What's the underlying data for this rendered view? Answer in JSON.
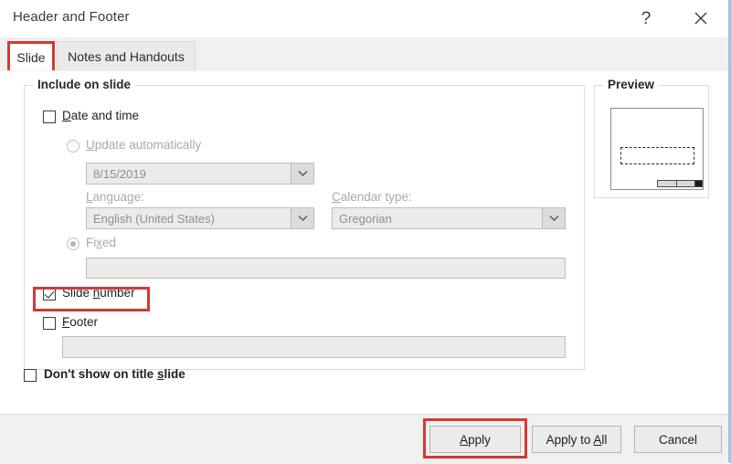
{
  "window": {
    "title": "Header and Footer",
    "help_icon": "question-mark-icon",
    "close_icon": "close-icon"
  },
  "tabs": [
    {
      "label": "Slide",
      "active": true,
      "highlighted": true
    },
    {
      "label": "Notes and Handouts",
      "active": false,
      "highlighted": false
    }
  ],
  "include_group": {
    "legend": "Include on slide",
    "date_and_time": {
      "label_pre": "",
      "label_accel": "D",
      "label_post": "ate and time",
      "checked": false
    },
    "update_automatically": {
      "label_accel": "U",
      "label_post": "pdate automatically",
      "selected": false,
      "disabled": true
    },
    "date_combo": {
      "value": "8/15/2019",
      "disabled": true,
      "arrow_icon": "chevron-down-icon"
    },
    "language": {
      "label_accel": "L",
      "label_post": "anguage:",
      "value": "English (United States)",
      "disabled": true,
      "arrow_icon": "chevron-down-icon"
    },
    "calendar_type": {
      "label_accel": "C",
      "label_post": "alendar type:",
      "value": "Gregorian",
      "disabled": true,
      "arrow_icon": "chevron-down-icon"
    },
    "fixed": {
      "label_pre": "Fi",
      "label_accel": "x",
      "label_post": "ed",
      "selected": true,
      "disabled": true
    },
    "fixed_field": {
      "value": "",
      "placeholder": "",
      "disabled": true
    },
    "slide_number": {
      "label_pre": "Slide ",
      "label_accel": "n",
      "label_post": "umber",
      "checked": true,
      "highlighted": true
    },
    "footer": {
      "label_accel": "F",
      "label_post": "ooter",
      "checked": false
    },
    "footer_field": {
      "value": "",
      "placeholder": "",
      "disabled": false
    }
  },
  "preview": {
    "legend": "Preview",
    "thumbnail_name": "slide-thumbnail"
  },
  "dont_show": {
    "label_pre": "Don't show on title ",
    "label_accel": "s",
    "label_post": "lide",
    "checked": false
  },
  "buttons": {
    "apply": {
      "pre": "",
      "accel": "A",
      "post": "pply",
      "highlighted": true
    },
    "apply_to_all": {
      "pre": "Apply to ",
      "accel": "A",
      "post": "ll",
      "highlighted": false
    },
    "cancel": {
      "pre": "Cancel",
      "accel": "",
      "post": "",
      "highlighted": false
    }
  },
  "colors": {
    "annotation": "#d23b34",
    "dialog_bg": "#ffffff",
    "footer_bg": "#f0f0f0",
    "disabled_text": "#a9a9a9"
  }
}
